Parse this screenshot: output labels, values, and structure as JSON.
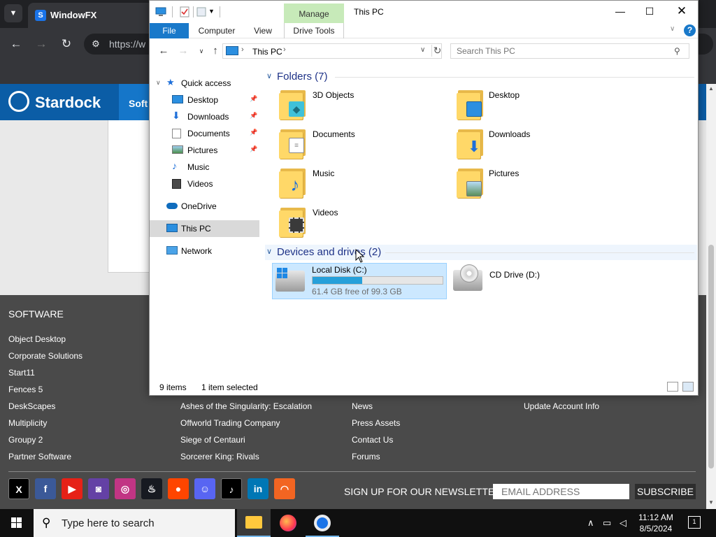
{
  "browser": {
    "tab_title": "WindowFX",
    "url": "https://w",
    "site_brand": "Stardock",
    "site_nav": "Soft",
    "footer": {
      "heading": "SOFTWARE",
      "col1": [
        "Object Desktop",
        "Corporate Solutions",
        "Start11",
        "Fences 5",
        "DeskScapes",
        "Multiplicity",
        "Groupy 2",
        "Partner Software"
      ],
      "col2": [
        "Ashes of the Singularity: Escalation",
        "Offworld Trading Company",
        "Siege of Centauri",
        "Sorcerer King: Rivals"
      ],
      "col3": [
        "News",
        "Press Assets",
        "Contact Us",
        "Forums"
      ],
      "col4": [
        "Update Account Info"
      ],
      "newsletter_label": "SIGN UP FOR OUR NEWSLETTER:",
      "email_placeholder": "EMAIL ADDRESS",
      "subscribe": "SUBSCRIBE"
    },
    "social_icons": [
      "x-icon",
      "facebook-icon",
      "youtube-icon",
      "twitch-icon",
      "instagram-icon",
      "steam-icon",
      "reddit-icon",
      "discord-icon",
      "tiktok-icon",
      "linkedin-icon",
      "rss-icon"
    ]
  },
  "explorer": {
    "manage_label": "Manage",
    "window_title": "This PC",
    "ribbon_tabs": [
      "File",
      "Computer",
      "View",
      "Drive Tools"
    ],
    "address": "This PC",
    "search_placeholder": "Search This PC",
    "nav": {
      "quick_access": "Quick access",
      "quick_items": [
        "Desktop",
        "Downloads",
        "Documents",
        "Pictures",
        "Music",
        "Videos"
      ],
      "onedrive": "OneDrive",
      "this_pc": "This PC",
      "network": "Network"
    },
    "folders_header": "Folders (7)",
    "folders": [
      "3D Objects",
      "Desktop",
      "Documents",
      "Downloads",
      "Music",
      "Pictures",
      "Videos"
    ],
    "devices_header": "Devices and drives (2)",
    "drives": [
      {
        "name": "Local Disk (C:)",
        "free": "61.4 GB free of 99.3 GB",
        "used_fraction": 0.382
      },
      {
        "name": "CD Drive (D:)"
      }
    ],
    "status_items": "9 items",
    "status_selected": "1 item selected"
  },
  "taskbar": {
    "search_placeholder": "Type here to search",
    "time": "11:12 AM",
    "date": "8/5/2024"
  }
}
